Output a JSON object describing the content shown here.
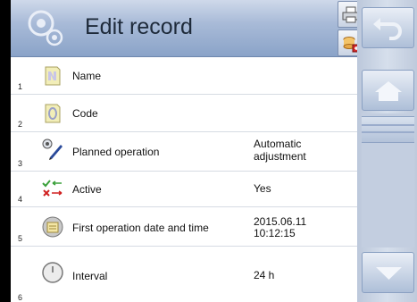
{
  "header": {
    "title": "Edit record",
    "logo_icon": "gear-settings-icon",
    "print_icon": "printer-icon",
    "export_icon": "export-database-icon"
  },
  "rows": [
    {
      "number": "1",
      "label": "Name",
      "value": "",
      "icon": "name-icon"
    },
    {
      "number": "2",
      "label": "Code",
      "value": "",
      "icon": "code-icon"
    },
    {
      "number": "3",
      "label": "Planned operation",
      "value": "Automatic adjustment",
      "value_line1": "Automatic",
      "value_line2": "adjustment",
      "icon": "planned-operation-icon"
    },
    {
      "number": "4",
      "label": "Active",
      "value": "Yes",
      "icon": "active-toggle-icon"
    },
    {
      "number": "5",
      "label": "First operation date and time",
      "value": "2015.06.11 10:12:15",
      "value_line1": "2015.06.11",
      "value_line2": "10:12:15",
      "icon": "date-time-icon"
    },
    {
      "number": "6",
      "label": "Interval",
      "value": "24 h",
      "icon": "clock-icon"
    }
  ],
  "side_panel": {
    "back_icon": "back-arrow-icon",
    "home_icon": "home-icon",
    "down_icon": "scroll-down-icon"
  },
  "colors": {
    "header": "#a9bbd8",
    "side_panel": "#c6d1e2",
    "row_divider": "#d6dbe3"
  }
}
